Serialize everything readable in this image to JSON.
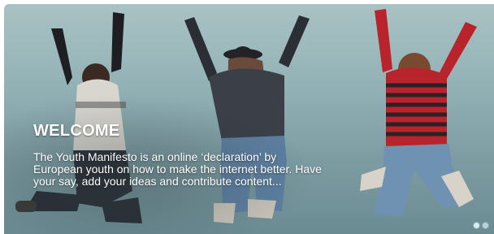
{
  "slider": {
    "title": "WELCOME",
    "description": "The Youth Manifesto is an online ‘declaration’ by European youth on how to make the internet better. Have your say, add your ideas and contribute content...",
    "dots": [
      {
        "label": "slide-1",
        "active": true
      },
      {
        "label": "slide-2",
        "active": false
      }
    ]
  }
}
